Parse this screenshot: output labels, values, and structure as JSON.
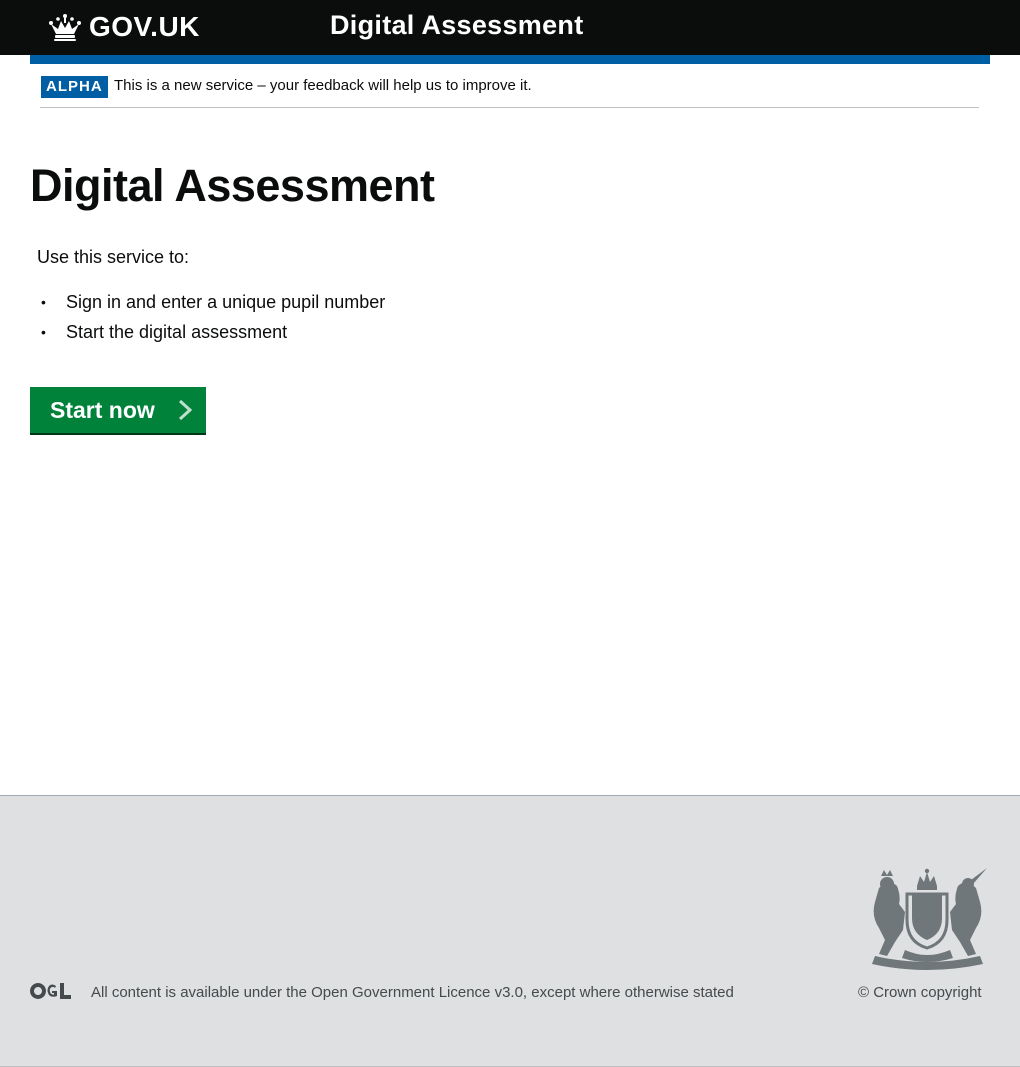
{
  "header": {
    "logo_text": "GOV.UK",
    "logo_icon": "crown-icon",
    "service_name": "Digital Assessment"
  },
  "phase_banner": {
    "tag": "ALPHA",
    "text": "This is a new service – your feedback will help us to improve it."
  },
  "main": {
    "title": "Digital Assessment",
    "intro": "Use this service to:",
    "bullets": [
      "Sign in and enter a unique pupil  number",
      "Start the digital assessment"
    ],
    "start_button": "Start now",
    "start_icon": "chevron-right-icon"
  },
  "footer": {
    "ogl_logo": "OGL",
    "licence_text": "All content is available under the Open Government Licence v3.0, except where otherwise stated",
    "crest_icon": "royal-coat-of-arms-icon",
    "copyright": "© Crown copyright"
  },
  "colors": {
    "header_bg": "#0b0c0c",
    "header_bar": "#005ea5",
    "phase_tag": "#005ea5",
    "button": "#00823b",
    "footer_bg": "#dee0e2",
    "footer_text": "#454a4c"
  }
}
